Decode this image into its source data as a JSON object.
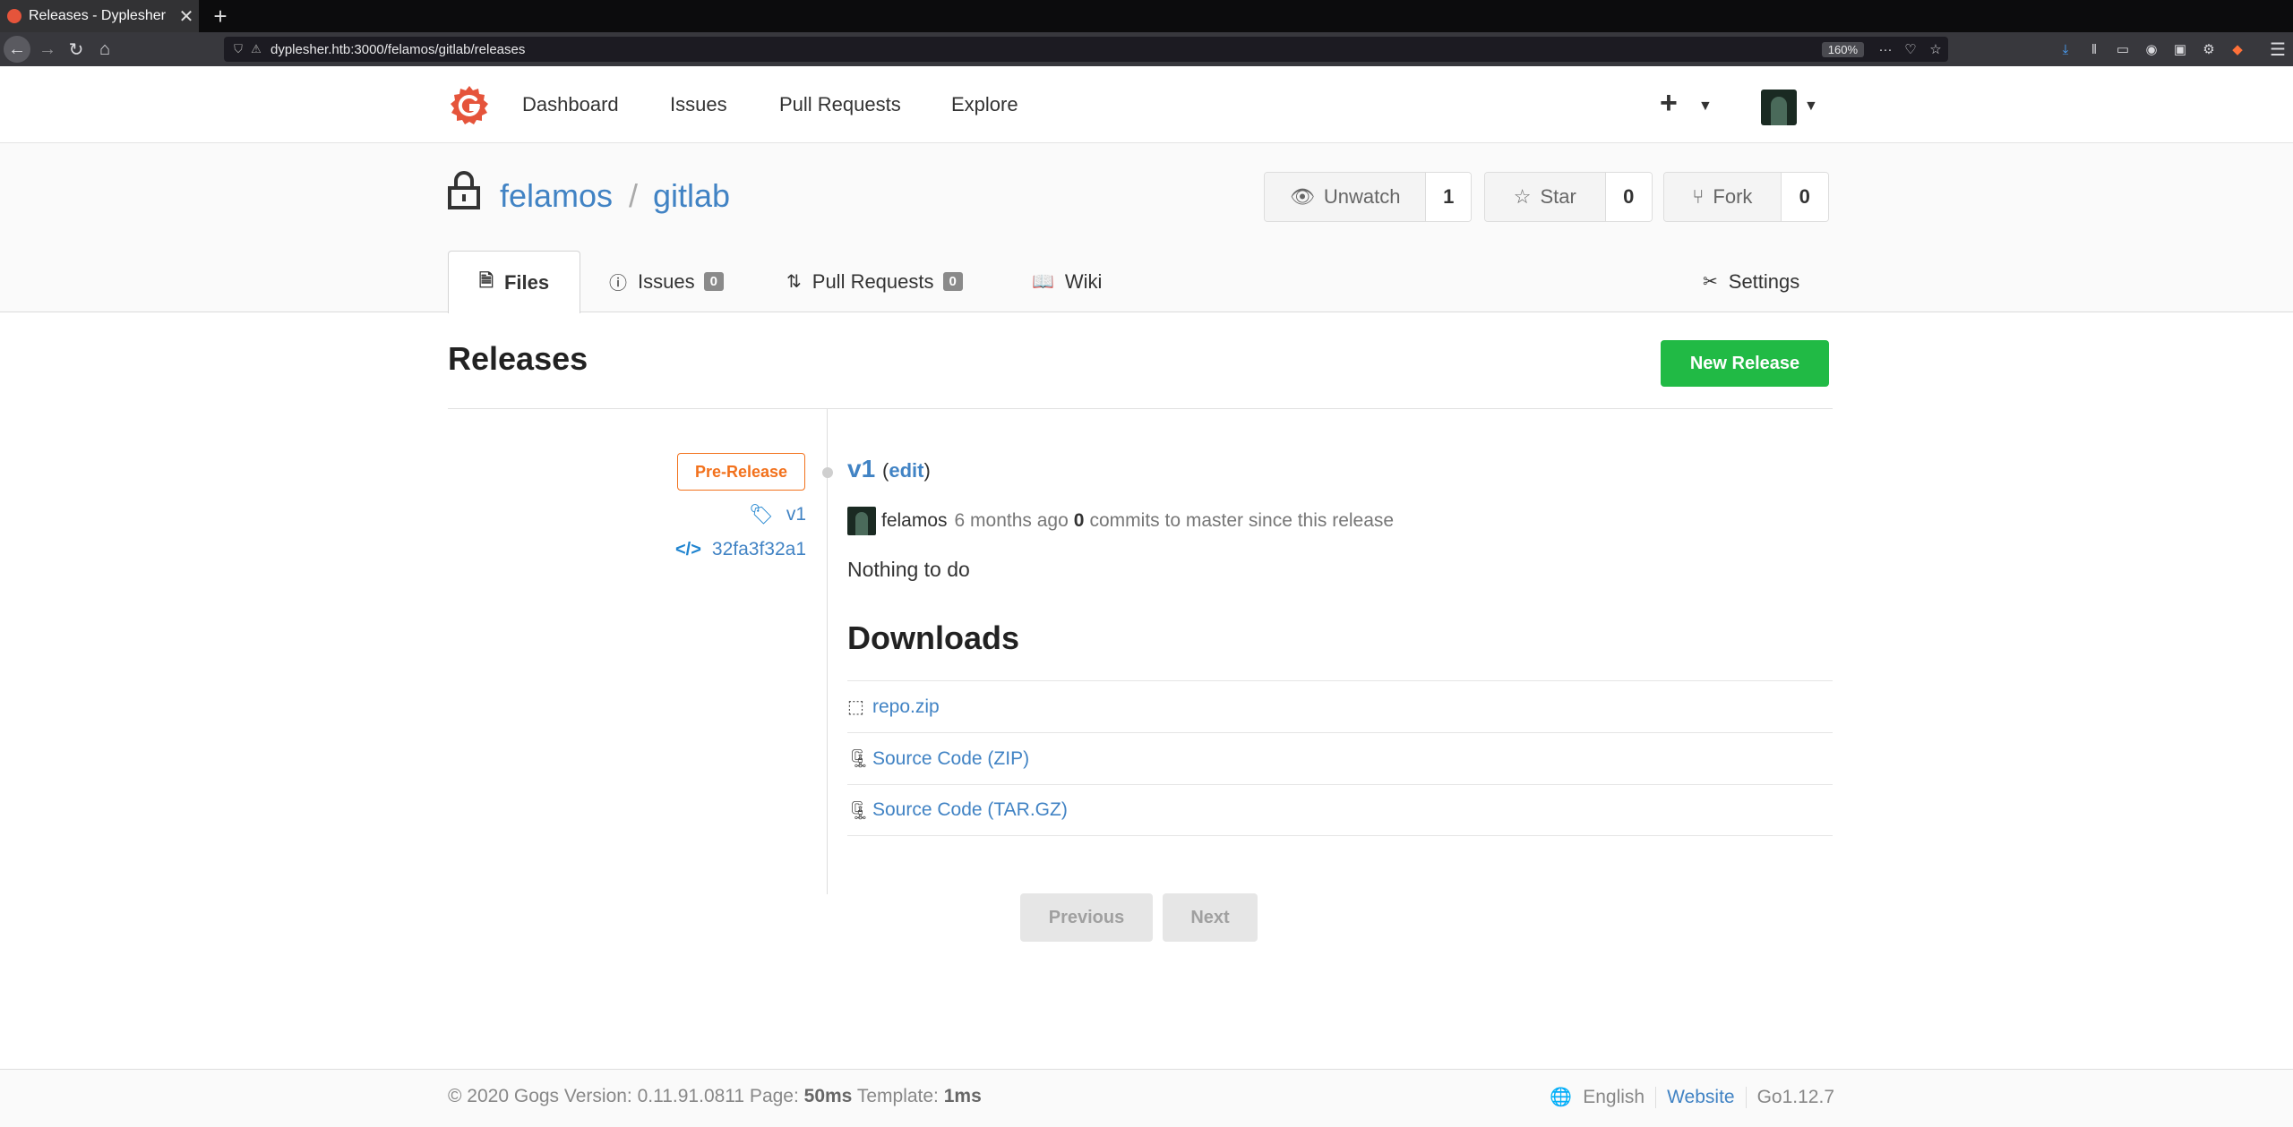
{
  "browser": {
    "tab_title": "Releases - Dyplesher",
    "tab_close": "✕",
    "new_tab": "+",
    "url": "dyplesher.htb:3000/felamos/gitlab/releases",
    "zoom": "160%",
    "menu_glyph": "☰"
  },
  "header": {
    "nav": [
      "Dashboard",
      "Issues",
      "Pull Requests",
      "Explore"
    ],
    "plus": "+"
  },
  "repo": {
    "owner": "felamos",
    "separator": "/",
    "name": "gitlab",
    "watch_label": "Unwatch",
    "watch_count": "1",
    "star_label": "Star",
    "star_count": "0",
    "fork_label": "Fork",
    "fork_count": "0",
    "tabs": {
      "files": "Files",
      "issues": "Issues",
      "issues_count": "0",
      "pulls": "Pull Requests",
      "pulls_count": "0",
      "wiki": "Wiki",
      "settings": "Settings"
    }
  },
  "releases": {
    "title": "Releases",
    "new_release": "New Release",
    "items": [
      {
        "badge": "Pre-Release",
        "tag": "v1",
        "commit": "32fa3f32a1",
        "title": "v1",
        "edit_open": "(",
        "edit_label": "edit",
        "edit_close": ")",
        "author": "felamos",
        "time": "6 months ago",
        "commits_count": "0",
        "commits_text": "commits to master since this release",
        "note": "Nothing to do",
        "downloads_title": "Downloads",
        "downloads": [
          "repo.zip",
          "Source Code (ZIP)",
          "Source Code (TAR.GZ)"
        ]
      }
    ]
  },
  "pager": {
    "previous": "Previous",
    "next": "Next"
  },
  "footer": {
    "copyright": "© 2020 Gogs Version: 0.11.91.0811 Page:",
    "page_time": "50ms",
    "template_label": "Template:",
    "template_time": "1ms",
    "language": "English",
    "website": "Website",
    "go_version": "Go1.12.7"
  },
  "colors": {
    "link": "#4183c4",
    "primary_green": "#21ba45",
    "pre_release_orange": "#f2711c",
    "logo_red": "#e5543b"
  }
}
